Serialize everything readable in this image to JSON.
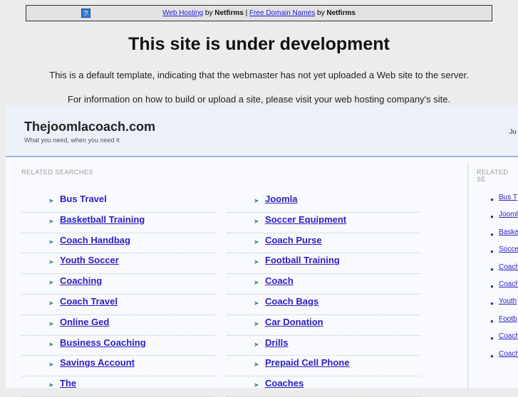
{
  "topbar": {
    "link1": "Web Hosting",
    "by1": "by",
    "brand1": "Netfirms",
    "sep": "|",
    "link2": "Free Domain Names",
    "by2": "by",
    "brand2": "Netfirms",
    "help": "?"
  },
  "heading": "This site is under development",
  "para1": "This is a default template, indicating that the webmaster has not yet uploaded a Web site to the server.",
  "para2": "For information on how to build or upload a site, please visit your web hosting company's site.",
  "site": {
    "name": "Thejoomlacoach.com",
    "tagline": "What you need, when you need it",
    "right_text": "Ju"
  },
  "related_label": "RELATED SEARCHES",
  "side_label": "RELATED SE",
  "left": [
    "Bus Travel",
    "Basketball Training",
    "Coach Handbag",
    "Youth Soccer",
    "Coaching",
    "Coach Travel",
    "Online Ged",
    "Business Coaching",
    "Savings Account",
    "The"
  ],
  "right": [
    "Joomla",
    "Soccer Equipment",
    "Coach Purse",
    "Football Training",
    "Coach",
    "Coach Bags",
    "Car Donation",
    "Drills",
    "Prepaid Cell Phone",
    "Coaches"
  ],
  "side": [
    "Bus T",
    "Jooml",
    "Baske",
    "Socce",
    "Coach",
    "Coach",
    "Youth",
    "Footb",
    "Coach",
    "Coach"
  ]
}
